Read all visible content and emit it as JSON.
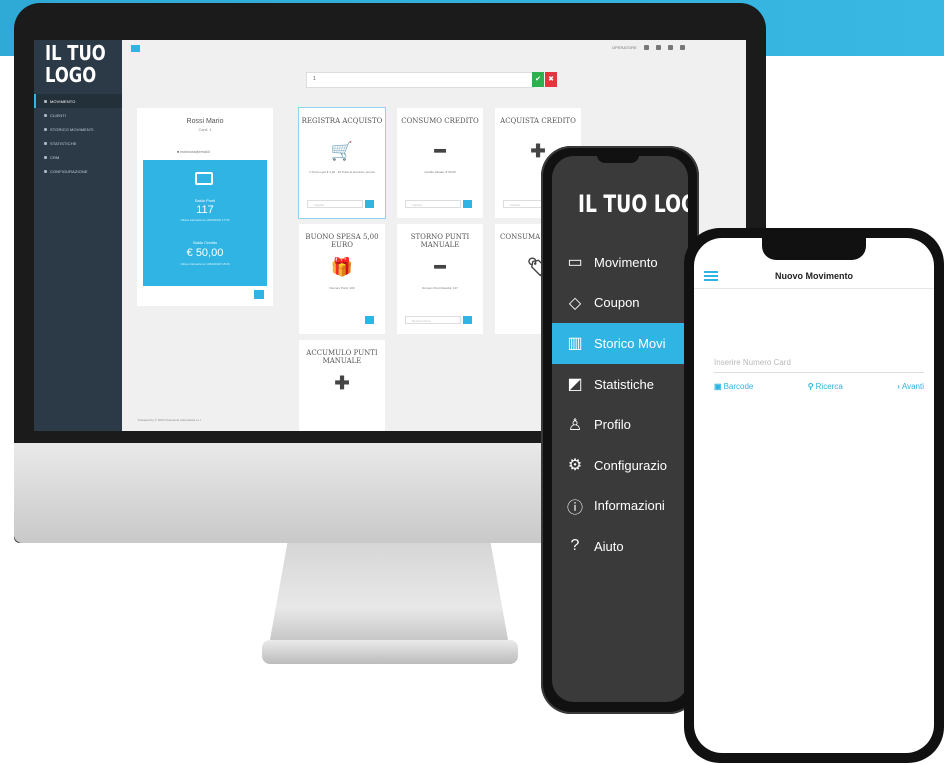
{
  "colors": {
    "accent": "#2fb4e3",
    "sidebar": "#2c3a47",
    "ok": "#2eb04f",
    "cancel": "#e2363c"
  },
  "desktop": {
    "logo_line1": "IL TUO",
    "logo_line2": "LOGO",
    "nav": [
      "MOVIMENTO",
      "CLIENTI",
      "STORICO MOVIMENTI",
      "STATISTICHE",
      "CRM",
      "CONFIGURAZIONE"
    ],
    "top_right_label": "OPERATORE",
    "search_value": "1",
    "ok_symbol": "✔",
    "cancel_symbol": "✖",
    "customer": {
      "name": "Rossi Mario",
      "card": "Card: 1",
      "subtitle": "■ marioross@email.it",
      "points_label": "Saldo Punti",
      "points_value": "117",
      "points_note": "Ultima transazione 10/03/2020 17:55",
      "credit_label": "Saldo Credito",
      "credit_value": "€ 50,00",
      "credit_note": "Ultima transazione 10/03/2020 18:00"
    },
    "tiles": [
      {
        "title": "REGISTRA ACQUISTO",
        "icon": "cart-icon",
        "glyph": "🛒",
        "text": "1 Punto ogni € 1,00 · 45 Punti al prossimo premio",
        "input": "Importo"
      },
      {
        "title": "CONSUMO CREDITO",
        "icon": "minus-icon",
        "glyph": "━",
        "text": "Credito Attuale: € 50,00",
        "input": "Importo"
      },
      {
        "title": "ACQUISTA CREDITO",
        "icon": "plus-icon",
        "glyph": "✚",
        "text": "",
        "input": "Importo"
      },
      {
        "title": "BUONO SPESA 5,00 EURO",
        "icon": "gift-icon",
        "glyph": "🎁",
        "text": "Numero Punti: 100",
        "input": ""
      },
      {
        "title": "STORNO PUNTI MANUALE",
        "icon": "minus-icon",
        "glyph": "━",
        "text": "Numero Punti Residui: 117",
        "input": "Numero Punti"
      },
      {
        "title": "CONSUMA COUPON",
        "icon": "tag-icon",
        "glyph": "🏷",
        "text": "",
        "input": ""
      },
      {
        "title": "ACCUMULO PUNTI MANUALE",
        "icon": "plus-icon",
        "glyph": "✚",
        "text": "",
        "input": ""
      }
    ],
    "footer": "Powered by © 2020 Vivamente Informatica s.r.l."
  },
  "phone_menu": {
    "logo": "IL TUO LOGO",
    "items": [
      {
        "label": "Movimento",
        "icon": "card-icon",
        "glyph": "▭"
      },
      {
        "label": "Coupon",
        "icon": "tag-icon",
        "glyph": "◇"
      },
      {
        "label": "Storico Movi",
        "icon": "bars-icon",
        "glyph": "▥",
        "active": true
      },
      {
        "label": "Statistiche",
        "icon": "chart-icon",
        "glyph": "◩"
      },
      {
        "label": "Profilo",
        "icon": "user-icon",
        "glyph": "♙"
      },
      {
        "label": "Configurazio",
        "icon": "gear-icon",
        "glyph": "⚙"
      },
      {
        "label": "Informazioni",
        "icon": "info-icon",
        "glyph": "ⓘ"
      },
      {
        "label": "Aiuto",
        "icon": "help-icon",
        "glyph": "?"
      }
    ]
  },
  "phone_main": {
    "title": "Nuovo Movimento",
    "input_placeholder": "Inserire Numero Card",
    "barcode_label": "Barcode",
    "search_label": "Ricerca",
    "next_label": "Avanti"
  }
}
